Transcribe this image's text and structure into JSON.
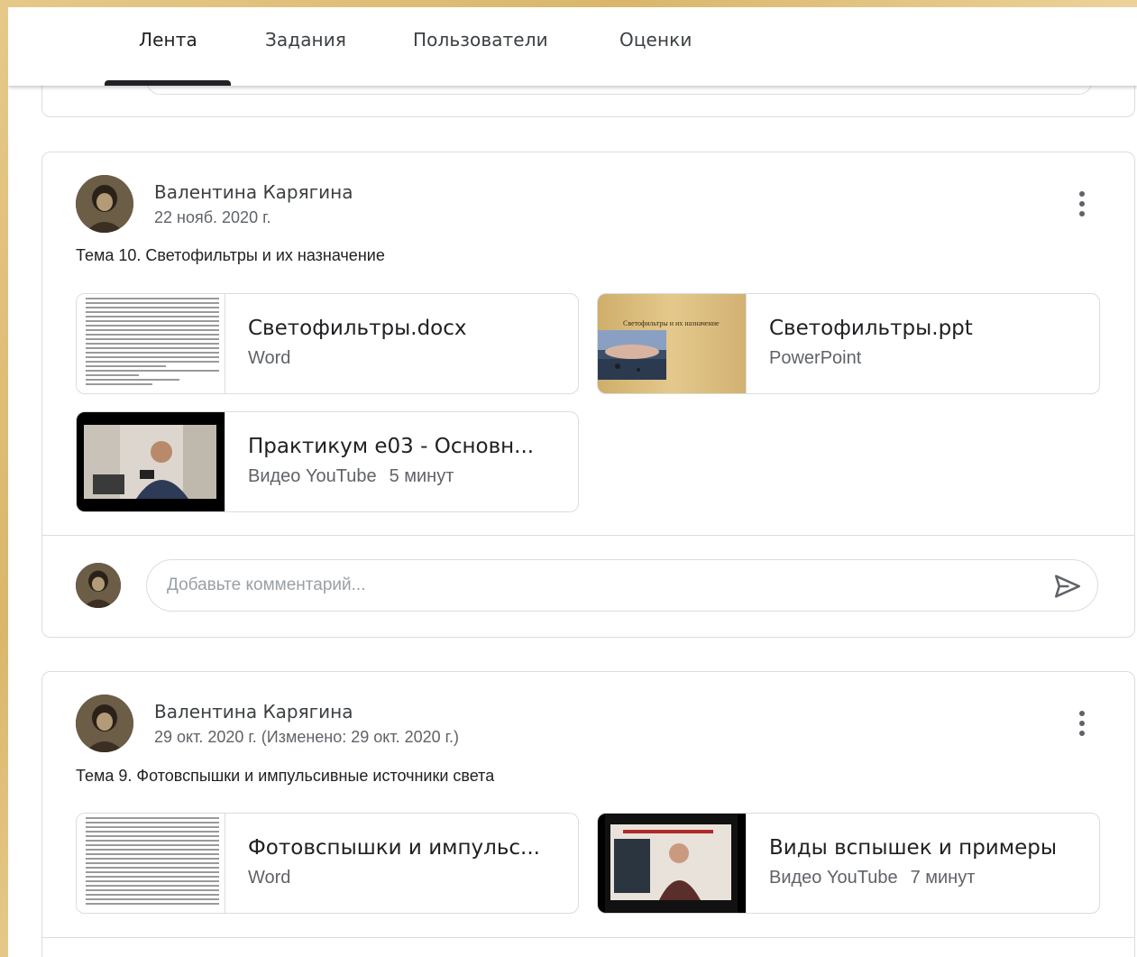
{
  "tabs": [
    {
      "label": "Лента",
      "active": true
    },
    {
      "label": "Задания"
    },
    {
      "label": "Пользователи"
    },
    {
      "label": "Оценки"
    }
  ],
  "posts": [
    {
      "author": "Валентина Карягина",
      "date": "22 нояб. 2020 г.",
      "text": "Тема 10. Светофильтры и их назначение",
      "attachments": [
        {
          "title": "Светофильтры.docx",
          "type": "Word"
        },
        {
          "title": "Светофильтры.ppt",
          "type": "PowerPoint",
          "slide_title": "Светофильтры и их назначение"
        },
        {
          "title": "Практикум е03 - Основн...",
          "type": "Видео YouTube",
          "duration": "5 минут"
        }
      ],
      "comment_placeholder": "Добавьте комментарий..."
    },
    {
      "author": "Валентина Карягина",
      "date": "29 окт. 2020 г. (Изменено: 29 окт. 2020 г.)",
      "text": "Тема 9. Фотовспышки и импульсивные источники света",
      "attachments": [
        {
          "title": "Фотовспышки и импульс...",
          "type": "Word"
        },
        {
          "title": "Виды вспышек и примеры",
          "type": "Видео YouTube",
          "duration": "7 минут"
        }
      ]
    }
  ],
  "colors": {
    "text": "#202124",
    "secondary": "#5f6368",
    "border": "#dadce0",
    "background": "#e6c98a"
  },
  "icons": {
    "menu": "more-vert-icon",
    "send": "send-icon"
  }
}
